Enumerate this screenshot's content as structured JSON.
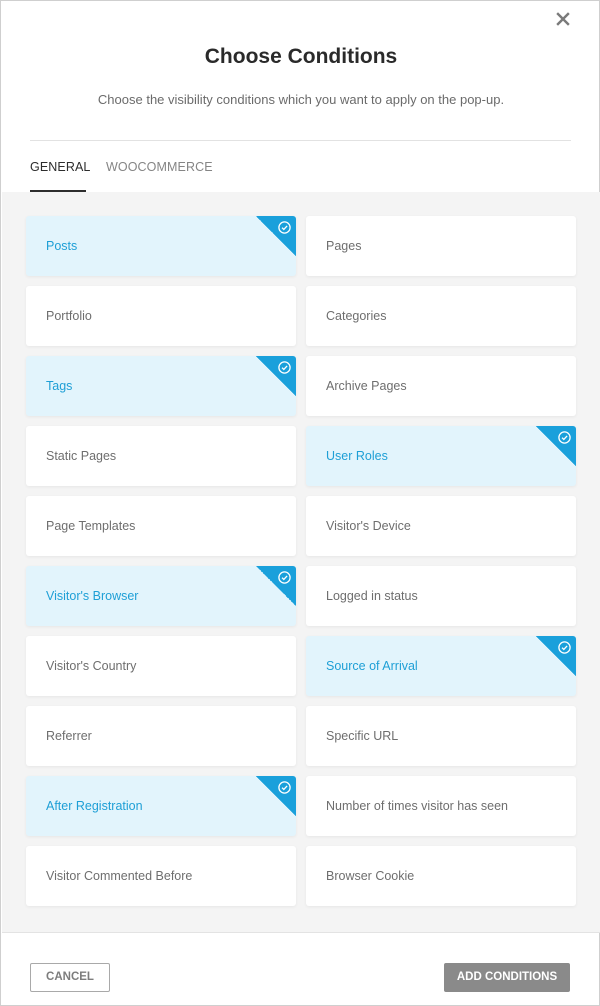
{
  "dialog": {
    "title": "Choose Conditions",
    "subtitle": "Choose the visibility conditions which you want to apply on the pop-up.",
    "close_icon": "close-icon"
  },
  "tabs": [
    {
      "label": "GENERAL",
      "active": true
    },
    {
      "label": "WOOCOMMERCE",
      "active": false
    }
  ],
  "conditions": [
    {
      "label": "Posts",
      "selected": true
    },
    {
      "label": "Pages",
      "selected": false
    },
    {
      "label": "Portfolio",
      "selected": false
    },
    {
      "label": "Categories",
      "selected": false
    },
    {
      "label": "Tags",
      "selected": true
    },
    {
      "label": "Archive Pages",
      "selected": false
    },
    {
      "label": "Static Pages",
      "selected": false
    },
    {
      "label": "User Roles",
      "selected": true
    },
    {
      "label": "Page Templates",
      "selected": false
    },
    {
      "label": "Visitor's Device",
      "selected": false
    },
    {
      "label": "Visitor's Browser",
      "selected": true
    },
    {
      "label": "Logged in status",
      "selected": false
    },
    {
      "label": "Visitor's Country",
      "selected": false
    },
    {
      "label": "Source of Arrival",
      "selected": true
    },
    {
      "label": "Referrer",
      "selected": false
    },
    {
      "label": "Specific URL",
      "selected": false
    },
    {
      "label": "After Registration",
      "selected": true
    },
    {
      "label": "Number of times visitor has seen",
      "selected": false
    },
    {
      "label": "Visitor Commented Before",
      "selected": false
    },
    {
      "label": "Browser Cookie",
      "selected": false
    }
  ],
  "footer": {
    "cancel_label": "CANCEL",
    "add_label": "ADD CONDITIONS"
  },
  "colors": {
    "accent": "#1aa0db",
    "selected_bg": "#e2f4fc",
    "primary_button": "#8a8a8a"
  }
}
